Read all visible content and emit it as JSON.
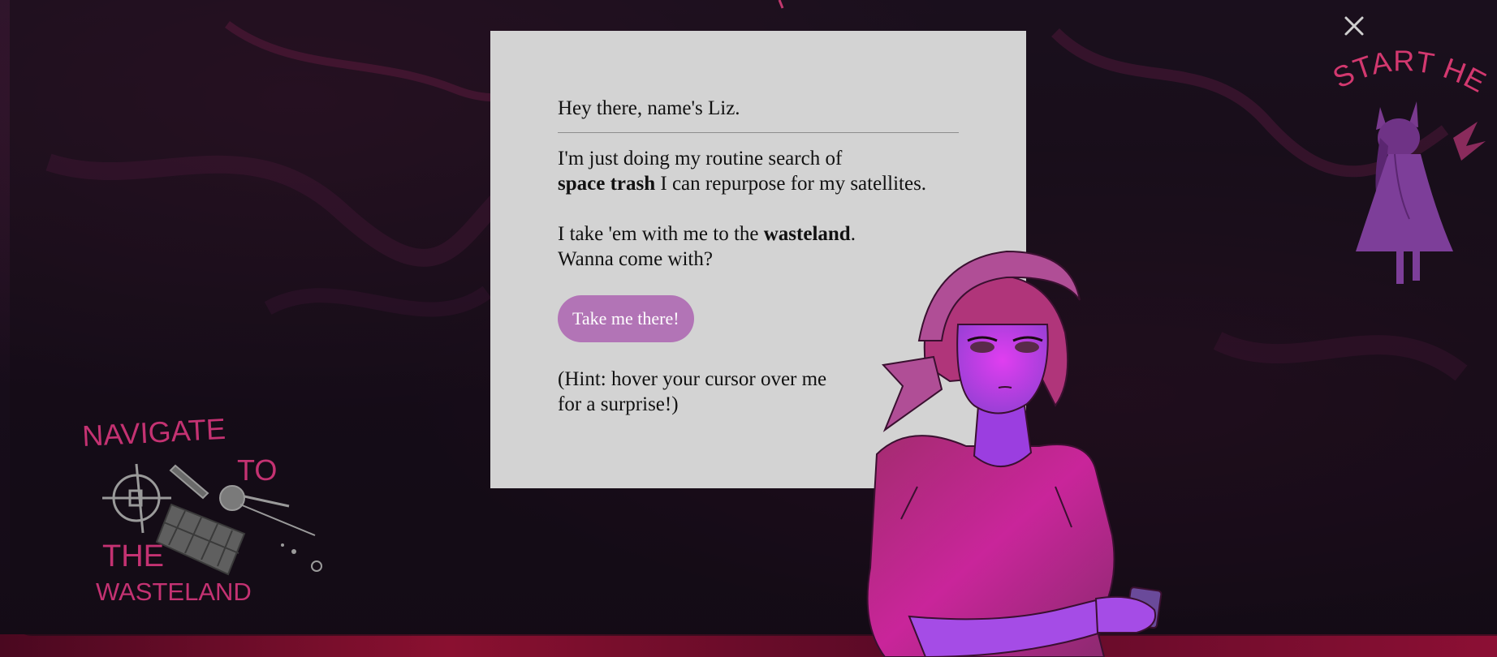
{
  "modal": {
    "close_label": "×",
    "greeting": "Hey there, name's Liz.",
    "line1_prefix": "I'm just doing my routine search of",
    "line1_bold": "space trash",
    "line1_suffix": " I can repurpose for my satellites.",
    "line2_prefix": "I take 'em with me to the ",
    "line2_bold": "wasteland",
    "line2_suffix": ".",
    "line3": "Wanna come with?",
    "cta_label": "Take me there!",
    "hint_line1": "(Hint: hover your cursor over me",
    "hint_line2": "for a surprise!)"
  },
  "art": {
    "start_here": "START HERE",
    "navigate_to": [
      "NAVIGATE",
      "TO"
    ],
    "the_wasteland": [
      "THE",
      "WASTELAND"
    ]
  },
  "colors": {
    "dialog_bg": "#d3d3d3",
    "cta_bg": "#b274b6",
    "art_pink": "#d2386f",
    "figure_magenta": "#c0258f"
  }
}
